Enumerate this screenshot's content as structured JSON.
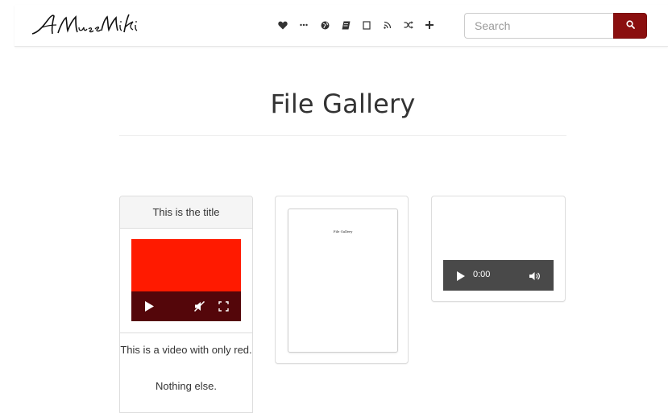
{
  "navbar": {
    "brand_alt": "A MuseWiki",
    "icons": [
      "heart-icon",
      "ellipsis-icon",
      "globe-icon",
      "book-icon",
      "bookmark-icon",
      "rss-icon",
      "random-icon",
      "plus-icon",
      "search-icon"
    ]
  },
  "search": {
    "placeholder": "Search"
  },
  "page": {
    "title": "File Gallery"
  },
  "cards": [
    {
      "type": "video",
      "title": "This is the title",
      "caption_1": "This is a video with only red.",
      "caption_2": "Nothing else."
    },
    {
      "type": "pdf",
      "preview_text": "File Gallery"
    },
    {
      "type": "audio",
      "time": "0:00"
    }
  ],
  "colors": {
    "accent": "#8a0f0f",
    "video_fill": "#ff1a00",
    "video_controls": "#54060a",
    "audio_controls": "#494949"
  }
}
